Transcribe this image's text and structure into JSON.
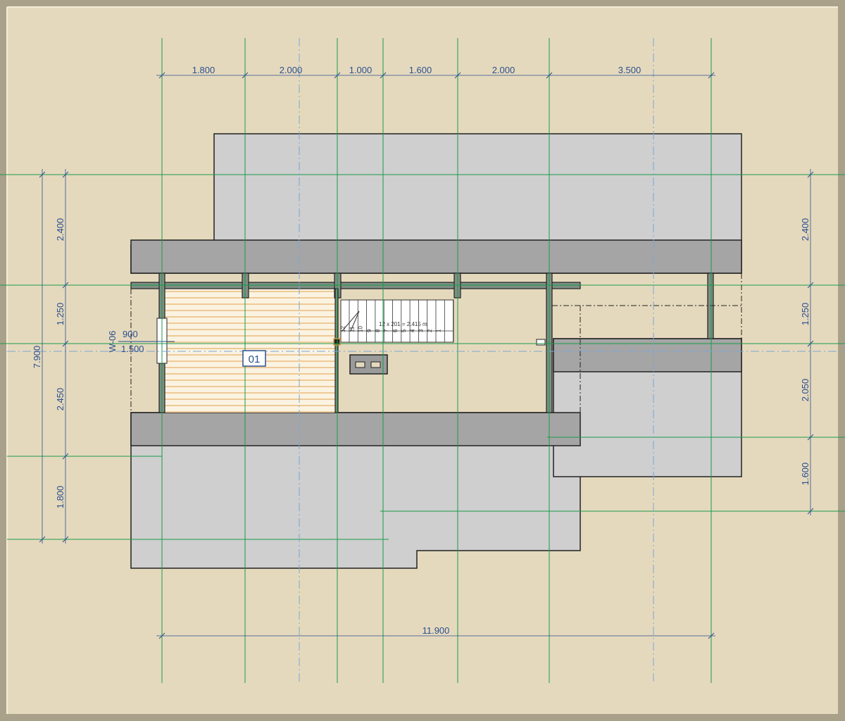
{
  "drawing": {
    "dimensions_top": [
      "1.800",
      "2.000",
      "1.000",
      "1.600",
      "2.000",
      "3.500"
    ],
    "dimension_bottom_total": "11.900",
    "dimensions_left": [
      "2.400",
      "1.250",
      "2.450",
      "1.800"
    ],
    "dimension_left_total": "7.900",
    "dimensions_right": [
      "2.400",
      "1.250",
      "2.050",
      "1.600"
    ],
    "window_tag": "W-06",
    "window_width": "900",
    "window_height": "1.500",
    "room_number": "01",
    "stair_label": "12 x 201 = 2.415 m",
    "stair_steps": [
      "12",
      "11",
      "10",
      "9",
      "8",
      "7",
      "6",
      "5",
      "4",
      "3",
      "2",
      "1"
    ]
  },
  "colors": {
    "background": "#e5d9bd",
    "frame": "#a9a18a",
    "roof": "#cfcfcf",
    "beam": "#a5a5a5",
    "wall": "#7f8f84",
    "grid_line": "#1a9a4a",
    "axis_line": "#7aa6d8",
    "dimension": "#2a4f8f",
    "deck_slat": "#e0a24a"
  }
}
